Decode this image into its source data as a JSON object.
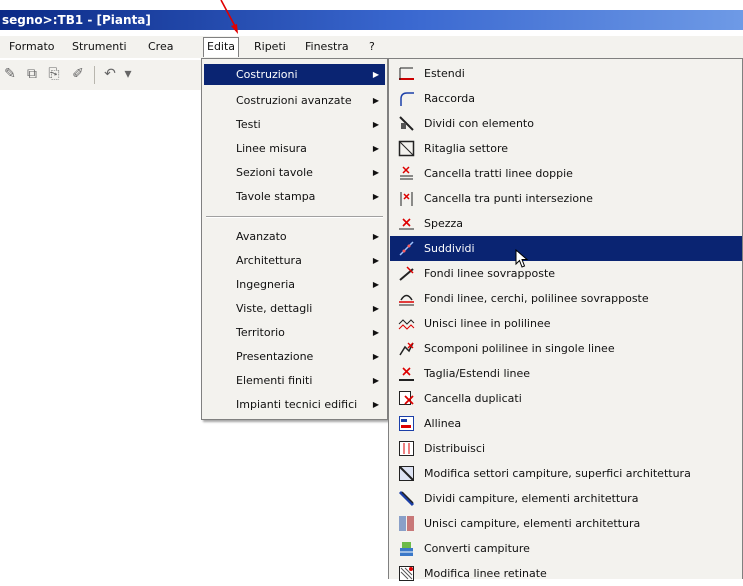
{
  "window": {
    "title": "segno>:TB1 - [Pianta]"
  },
  "menubar": {
    "items": [
      {
        "label": "Formato"
      },
      {
        "label": "Strumenti"
      },
      {
        "label": "Crea"
      },
      {
        "label": "Edita"
      },
      {
        "label": "Ripeti"
      },
      {
        "label": "Finestra"
      },
      {
        "label": "?"
      }
    ]
  },
  "edit_menu": {
    "group1": [
      {
        "label": "Costruzioni"
      },
      {
        "label": "Costruzioni avanzate"
      },
      {
        "label": "Testi"
      },
      {
        "label": "Linee misura"
      },
      {
        "label": "Sezioni tavole"
      },
      {
        "label": "Tavole stampa"
      }
    ],
    "group2": [
      {
        "label": "Avanzato"
      },
      {
        "label": "Architettura"
      },
      {
        "label": "Ingegneria"
      },
      {
        "label": "Viste, dettagli"
      },
      {
        "label": "Territorio"
      },
      {
        "label": "Presentazione"
      },
      {
        "label": "Elementi finiti"
      },
      {
        "label": "Impianti tecnici edifici"
      }
    ],
    "highlighted": "Costruzioni"
  },
  "submenu": {
    "items": [
      {
        "label": "Estendi",
        "icon": "extend-icon"
      },
      {
        "label": "Raccorda",
        "icon": "fillet-icon"
      },
      {
        "label": "Dividi con elemento",
        "icon": "divide-element-icon"
      },
      {
        "label": "Ritaglia settore",
        "icon": "trim-sector-icon"
      },
      {
        "label": "Cancella tratti linee doppie",
        "icon": "delete-double-lines-icon"
      },
      {
        "label": "Cancella tra punti intersezione",
        "icon": "delete-between-intersections-icon"
      },
      {
        "label": "Spezza",
        "icon": "break-icon"
      },
      {
        "label": "Suddividi",
        "icon": "subdivide-icon"
      },
      {
        "label": "Fondi linee sovrapposte",
        "icon": "merge-overlapping-lines-icon"
      },
      {
        "label": "Fondi linee, cerchi, polilinee sovrapposte",
        "icon": "merge-overlapping-curves-icon"
      },
      {
        "label": "Unisci linee in polilinee",
        "icon": "join-polylines-icon"
      },
      {
        "label": "Scomponi polilinee in singole linee",
        "icon": "explode-polylines-icon"
      },
      {
        "label": "Taglia/Estendi linee",
        "icon": "trim-extend-icon"
      },
      {
        "label": "Cancella duplicati",
        "icon": "delete-duplicates-icon"
      },
      {
        "label": "Allinea",
        "icon": "align-icon"
      },
      {
        "label": "Distribuisci",
        "icon": "distribute-icon"
      },
      {
        "label": "Modifica settori campiture, superfici architettura",
        "icon": "modify-hatch-sectors-icon"
      },
      {
        "label": "Dividi campiture, elementi architettura",
        "icon": "divide-hatches-icon"
      },
      {
        "label": "Unisci campiture, elementi architettura",
        "icon": "join-hatches-icon"
      },
      {
        "label": "Converti campiture",
        "icon": "convert-hatches-icon"
      },
      {
        "label": "Modifica linee retinate",
        "icon": "modify-screened-lines-icon"
      }
    ],
    "highlighted": "Suddividi"
  },
  "colors": {
    "highlight": "#0a2472",
    "menu_bg": "#f3f2ee",
    "titlebar": "#0b2a86",
    "annotation_arrow": "#e00000"
  }
}
